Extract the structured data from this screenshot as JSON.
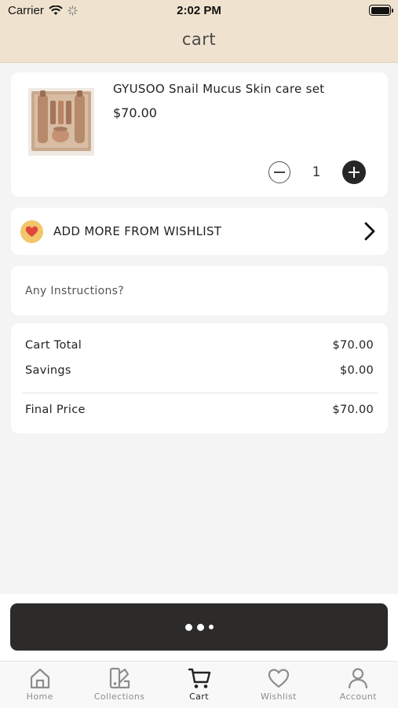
{
  "status_bar": {
    "carrier": "Carrier",
    "time": "2:02 PM"
  },
  "header": {
    "title": "cart"
  },
  "cart_item": {
    "name": "GYUSOO Snail Mucus Skin care set",
    "price": "$70.00",
    "quantity": "1"
  },
  "wishlist": {
    "label": "ADD MORE FROM WISHLIST"
  },
  "instructions": {
    "placeholder": "Any Instructions?"
  },
  "totals": {
    "cart_total_label": "Cart Total",
    "cart_total_value": "$70.00",
    "savings_label": "Savings",
    "savings_value": "$0.00",
    "final_label": "Final Price",
    "final_value": "$70.00"
  },
  "tabs": [
    {
      "label": "Home",
      "icon": "home-icon"
    },
    {
      "label": "Collections",
      "icon": "collections-icon"
    },
    {
      "label": "Cart",
      "icon": "cart-icon"
    },
    {
      "label": "Wishlist",
      "icon": "heart-icon"
    },
    {
      "label": "Account",
      "icon": "account-icon"
    }
  ],
  "colors": {
    "header_bg": "#efe3cf",
    "checkout_bg": "#2d2a2a",
    "heart_badge": "#f2c66a",
    "heart": "#e0473c"
  }
}
